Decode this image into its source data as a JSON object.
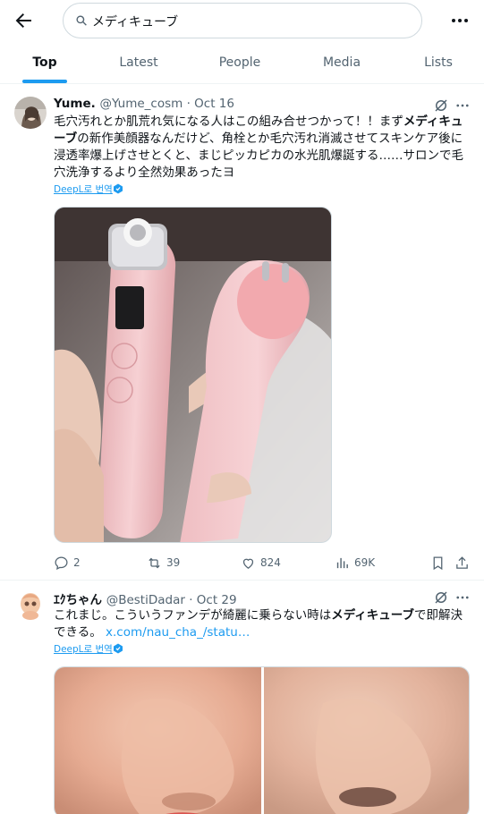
{
  "search": {
    "query": "メディキューブ"
  },
  "tabs": [
    {
      "label": "Top",
      "active": true
    },
    {
      "label": "Latest"
    },
    {
      "label": "People"
    },
    {
      "label": "Media"
    },
    {
      "label": "Lists"
    }
  ],
  "tweets": [
    {
      "name": "Yume.",
      "handle": "@Yume_cosm",
      "date": "Oct 16",
      "text_parts": [
        "毛穴汚れとか肌荒れ気になる人はこの組み合せつかって！！まず",
        "メディキューブ",
        "の新作美顔器なんだけど、角栓とか毛穴汚れ消滅させてスキンケア後に浸透率爆上げさせとくと、まじピッカピカの水光肌爆誕する……サロンで毛穴洗浄するより全然効果あったヨ"
      ],
      "translate": "DeepL로 번역",
      "stats": {
        "replies": "2",
        "retweets": "39",
        "likes": "824",
        "views": "69K"
      }
    },
    {
      "name": "ｴｸちゃん",
      "handle": "@BestiDadar",
      "date": "Oct 29",
      "text_parts": [
        "これまじ。こういうファンデが綺麗に乗らない時は",
        "メディキューブ",
        "で即解決できる。 "
      ],
      "link": "x.com/nau_cha_/statu…",
      "translate": "DeepL로 번역"
    }
  ],
  "colors": {
    "accent": "#1d9bf0",
    "text": "#0f1419",
    "muted": "#536471",
    "border": "#eff3f4"
  }
}
